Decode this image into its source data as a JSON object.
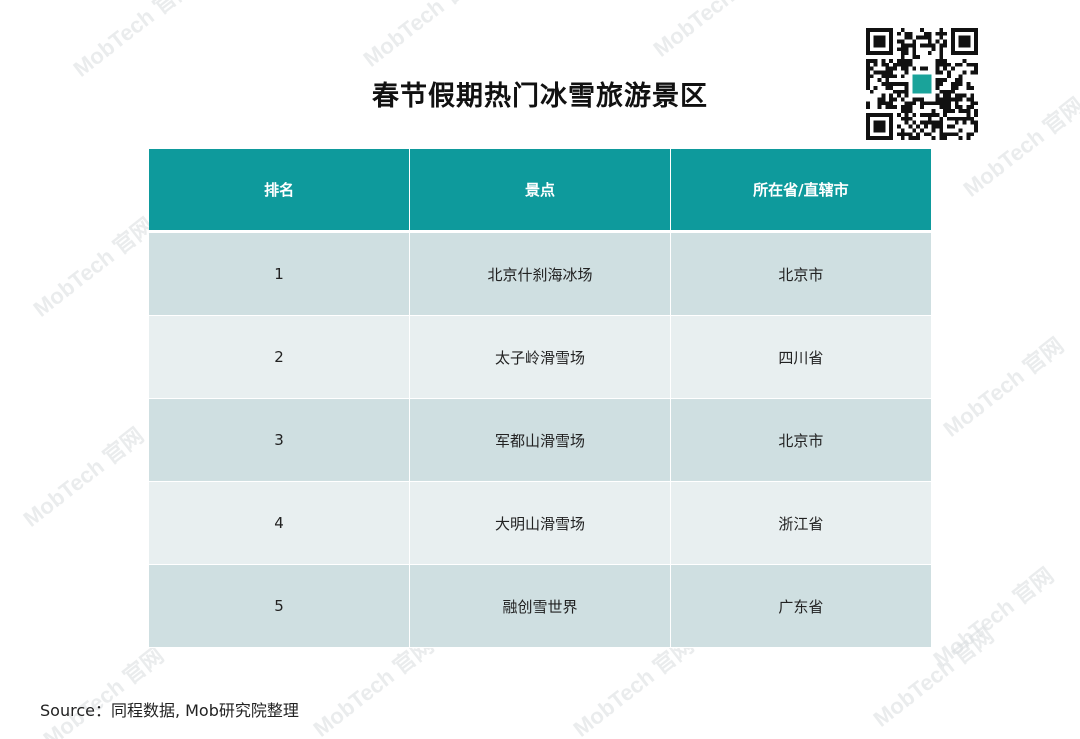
{
  "title": "春节假期热门冰雪旅游景区",
  "watermark_text": "MobTech 官网",
  "table": {
    "headers": [
      "排名",
      "景点",
      "所在省/直辖市"
    ],
    "rows": [
      [
        "1",
        "北京什刹海冰场",
        "北京市"
      ],
      [
        "2",
        "太子岭滑雪场",
        "四川省"
      ],
      [
        "3",
        "军都山滑雪场",
        "北京市"
      ],
      [
        "4",
        "大明山滑雪场",
        "浙江省"
      ],
      [
        "5",
        "融创雪世界",
        "广东省"
      ]
    ]
  },
  "source": "Source：同程数据, Mob研究院整理",
  "colors": {
    "header_bg": "#0e9a9c",
    "row_odd": "#cfdfe1",
    "row_even": "#e8eff0",
    "qr_accent": "#1aa39a"
  },
  "icons": {
    "qr_code": "qr-code-icon"
  }
}
